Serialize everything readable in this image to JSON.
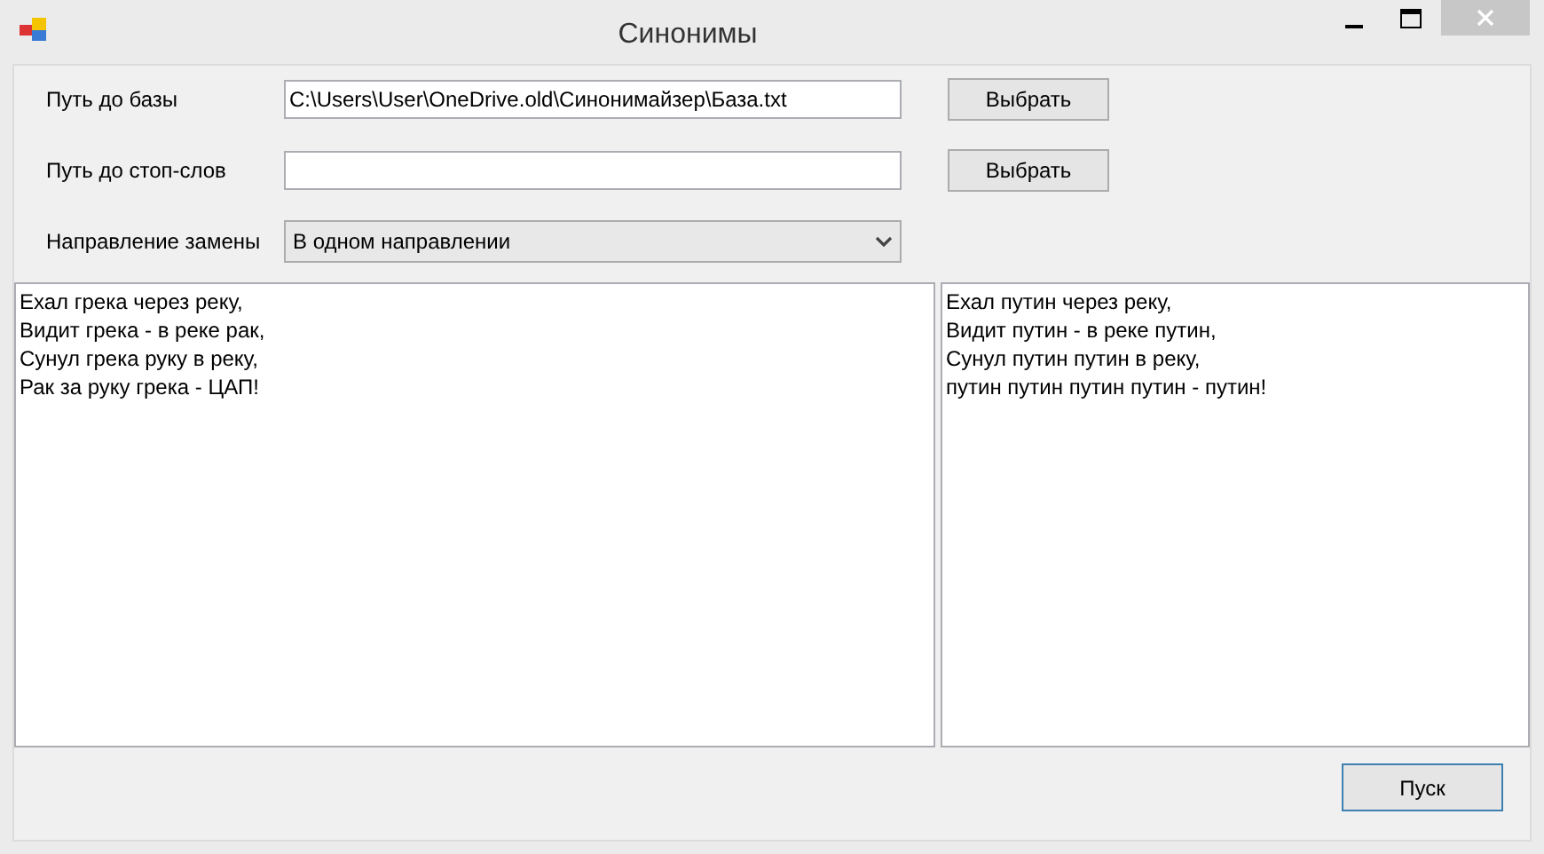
{
  "window": {
    "title": "Синонимы"
  },
  "fields": [
    {
      "kind": "text",
      "label": "Путь до базы",
      "value": "C:\\Users\\User\\OneDrive.old\\Синонимайзер\\База.txt",
      "button": "Выбрать"
    },
    {
      "kind": "text",
      "label": "Путь до стоп-слов",
      "button": "Выбрать"
    },
    {
      "kind": "dropdown",
      "label": "Направление замены",
      "value": "В одном направлении"
    }
  ],
  "source_text": [
    "Ехал грека через реку,",
    "Видит грека - в реке рак,",
    "Сунул грека руку в реку,",
    "Рак за руку грека - ЦАП!"
  ],
  "result_text": [
    "Ехал путин через реку,",
    "Видит путин - в реке путин,",
    "Сунул путин путин в реку,",
    "путин путин путин путин - путин!"
  ],
  "run_button": {
    "label": "Пуск",
    "focused": true
  }
}
